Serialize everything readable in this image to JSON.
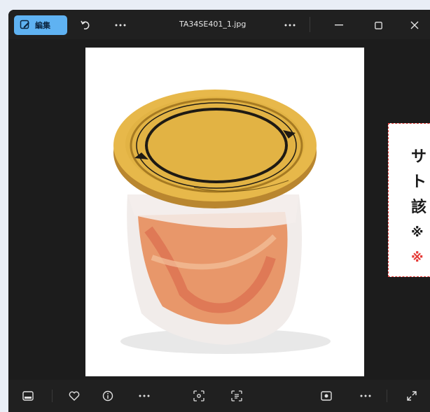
{
  "titlebar": {
    "edit_label": "編集",
    "filename": "TA34SE401_1.jpg",
    "icons": [
      "edit-icon",
      "rotate-icon",
      "more-icon",
      "more-icon",
      "minimize-icon",
      "maximize-icon",
      "close-icon"
    ]
  },
  "overlay": {
    "lines": [
      "サ",
      "ト",
      "該",
      "※",
      "※"
    ]
  },
  "bottombar": {
    "icons": [
      "filmstrip-icon",
      "favorite-icon",
      "info-icon",
      "more-icon",
      "visual-search-icon",
      "text-recognition-icon",
      "screen-mode-icon",
      "more-icon",
      "fullscreen-icon"
    ]
  },
  "colors": {
    "accent": "#5fb2f2",
    "overlay_border": "#e53935",
    "window_bg": "#1c1c1c"
  }
}
